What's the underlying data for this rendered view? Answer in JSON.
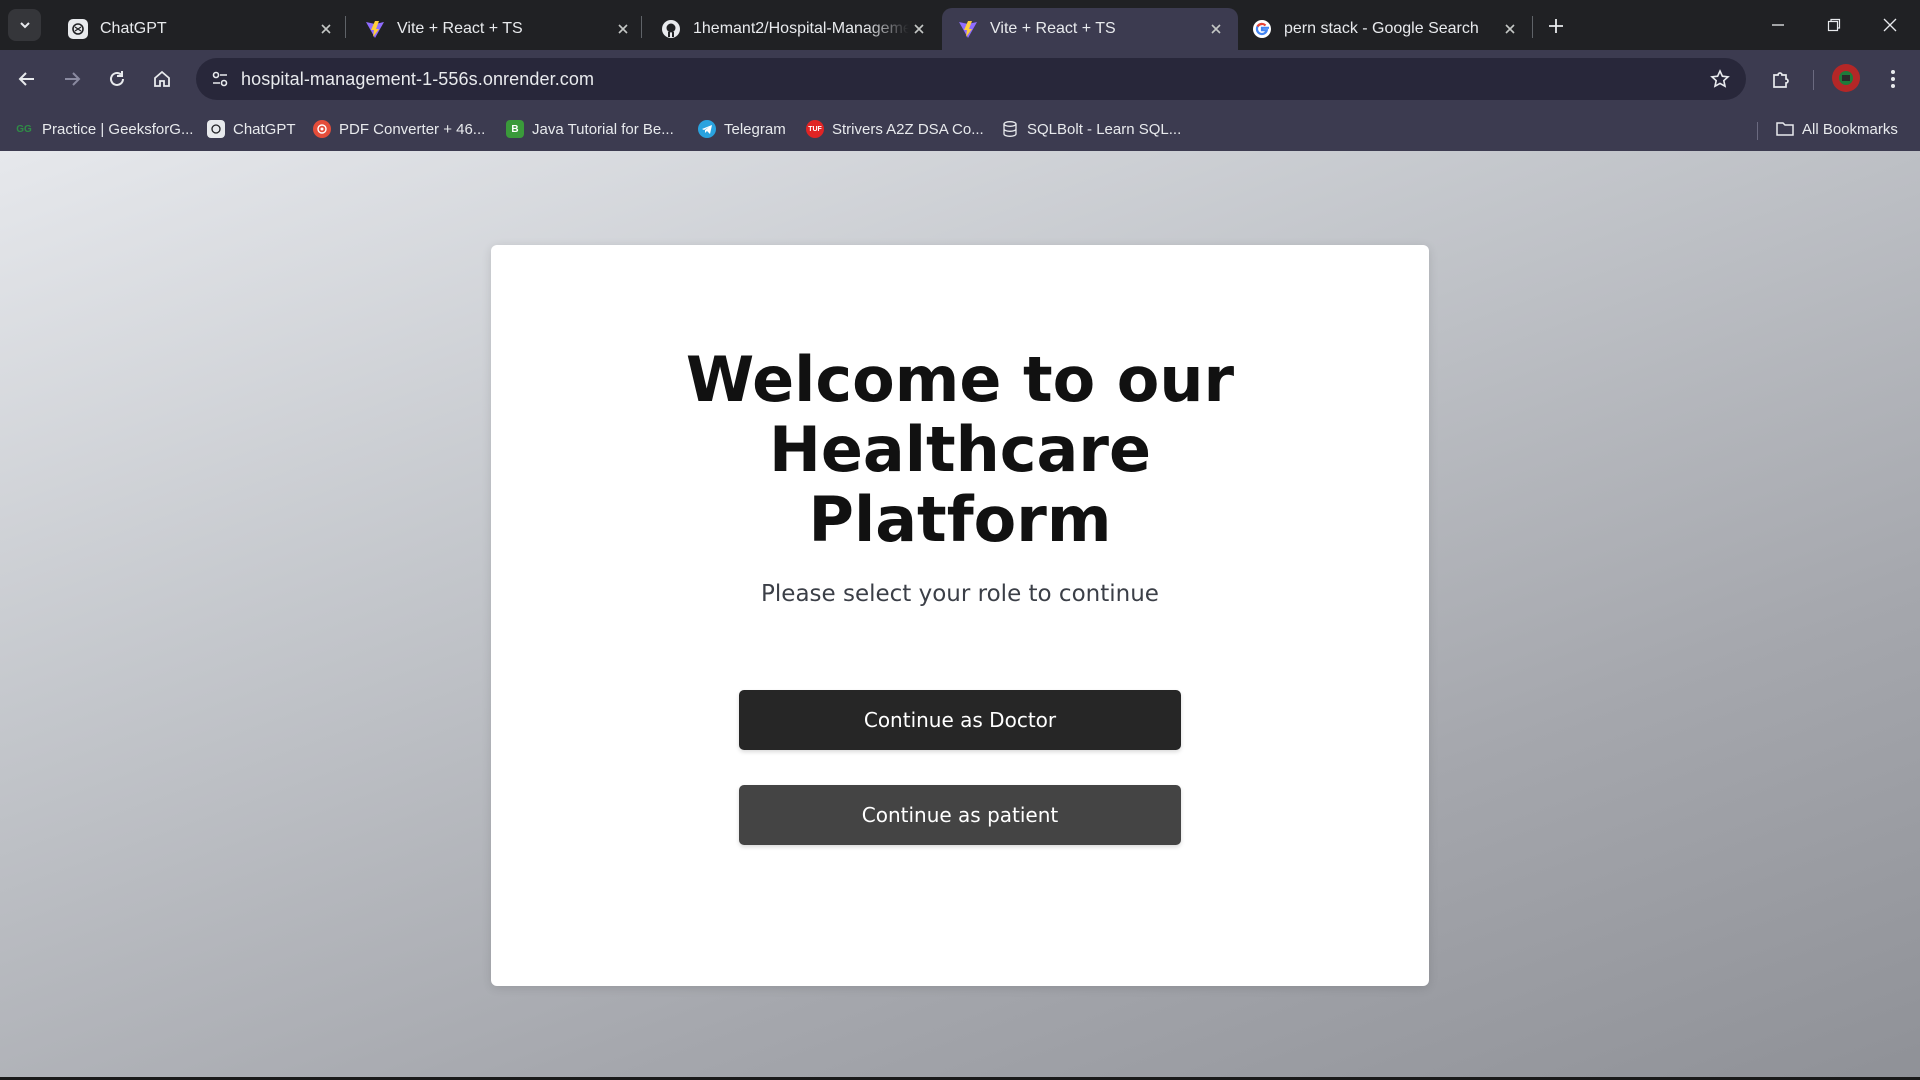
{
  "browser": {
    "tabs": [
      {
        "title": "ChatGPT",
        "icon": "chatgpt-icon",
        "active": false
      },
      {
        "title": "Vite + React + TS",
        "icon": "vite-icon",
        "active": false
      },
      {
        "title": "1hemant2/Hospital-Manageme",
        "icon": "github-icon",
        "active": false
      },
      {
        "title": "Vite + React + TS",
        "icon": "vite-icon",
        "active": true
      },
      {
        "title": "pern stack - Google Search",
        "icon": "google-icon",
        "active": false
      }
    ],
    "url": "hospital-management-1-556s.onrender.com",
    "bookmarks": [
      {
        "label": "Practice | GeeksforG...",
        "icon": "gfg-icon"
      },
      {
        "label": "ChatGPT",
        "icon": "chatgpt-icon"
      },
      {
        "label": "PDF Converter + 46...",
        "icon": "pdf-icon"
      },
      {
        "label": "Java Tutorial for Be...",
        "icon": "java-icon"
      },
      {
        "label": "Telegram",
        "icon": "telegram-icon"
      },
      {
        "label": "Strivers A2Z DSA Co...",
        "icon": "tuf-icon"
      },
      {
        "label": "SQLBolt - Learn SQL...",
        "icon": "database-icon"
      }
    ],
    "all_bookmarks_label": "All Bookmarks",
    "colors": {
      "frame": "#202124",
      "toolbar": "#3c3b50",
      "omnibox": "#28273a"
    }
  },
  "page": {
    "heading_lines": [
      "Welcome to our",
      "Healthcare",
      "Platform"
    ],
    "subtitle": "Please select your role to continue",
    "doctor_button": "Continue as Doctor",
    "patient_button": "Continue as patient",
    "colors": {
      "doctor_button": "#262626",
      "patient_button": "#444444",
      "card": "#ffffff"
    }
  }
}
